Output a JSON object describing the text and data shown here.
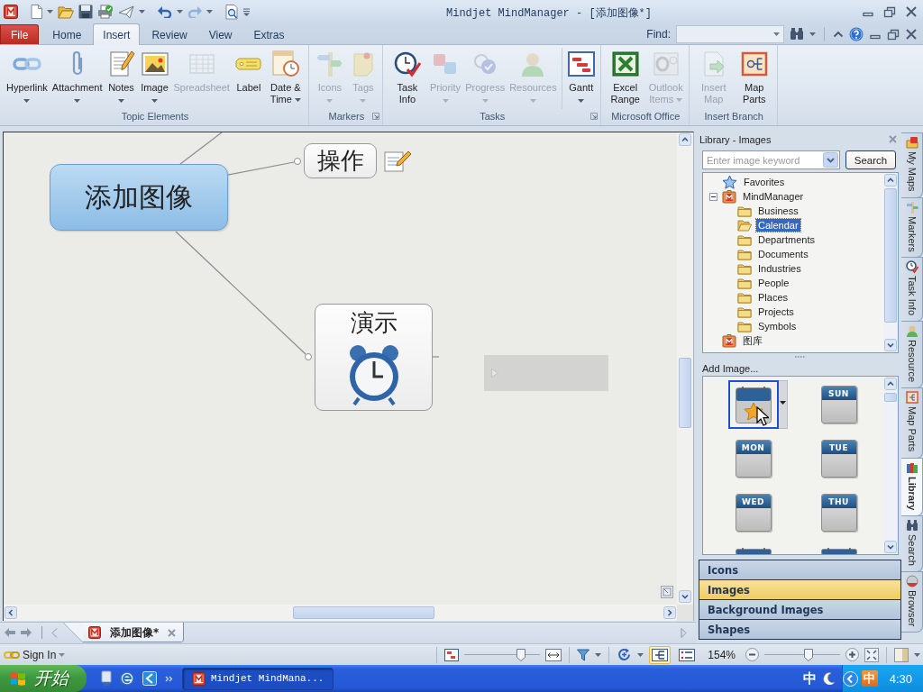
{
  "window": {
    "title": "Mindjet MindManager - [添加图像*]"
  },
  "ribbon_tabs": [
    {
      "label": "File",
      "kind": "file",
      "selected": false
    },
    {
      "label": "Home",
      "kind": "tab",
      "selected": false
    },
    {
      "label": "Insert",
      "kind": "tab",
      "selected": true
    },
    {
      "label": "Review",
      "kind": "tab",
      "selected": false
    },
    {
      "label": "View",
      "kind": "tab",
      "selected": false
    },
    {
      "label": "Extras",
      "kind": "tab",
      "selected": false
    }
  ],
  "find": {
    "label": "Find:"
  },
  "ribbon_groups": [
    {
      "label": "Topic Elements",
      "launcher": false,
      "sections": [
        [
          {
            "label": "Hyperlink",
            "disabled": false,
            "dropdown": true
          },
          {
            "label": "Attachment",
            "disabled": false,
            "dropdown": true
          },
          {
            "label": "Notes",
            "disabled": false,
            "dropdown": true
          },
          {
            "label": "Image",
            "disabled": false,
            "dropdown": true
          },
          {
            "label": "Spreadsheet",
            "disabled": true,
            "dropdown": false
          },
          {
            "label": "Label",
            "disabled": false,
            "dropdown": false
          },
          {
            "label": "Date & Time",
            "disabled": false,
            "dropdown": true
          }
        ]
      ]
    },
    {
      "label": "Markers",
      "launcher": true,
      "sections": [
        [
          {
            "label": "Icons",
            "disabled": true,
            "dropdown": true
          },
          {
            "label": "Tags",
            "disabled": true,
            "dropdown": true
          }
        ]
      ]
    },
    {
      "label": "Tasks",
      "launcher": true,
      "sections": [
        [
          {
            "label": "Task Info",
            "disabled": false,
            "dropdown": false
          },
          {
            "label": "Priority",
            "disabled": true,
            "dropdown": true
          },
          {
            "label": "Progress",
            "disabled": true,
            "dropdown": true
          },
          {
            "label": "Resources",
            "disabled": true,
            "dropdown": true
          }
        ],
        [
          {
            "label": "Gantt",
            "disabled": false,
            "dropdown": true
          }
        ]
      ]
    },
    {
      "label": "Microsoft Office",
      "launcher": false,
      "sections": [
        [
          {
            "label": "Excel Range",
            "disabled": false,
            "dropdown": false
          },
          {
            "label": "Outlook Items",
            "disabled": true,
            "dropdown": true
          }
        ]
      ]
    },
    {
      "label": "Insert Branch",
      "launcher": false,
      "sections": [
        [
          {
            "label": "Insert Map",
            "disabled": true,
            "dropdown": false
          },
          {
            "label": "Map Parts",
            "disabled": false,
            "dropdown": false
          }
        ]
      ]
    }
  ],
  "map": {
    "central_topic": {
      "text": "添加图像"
    },
    "topics": [
      {
        "text": "操作",
        "kind": "note"
      },
      {
        "text": "演示",
        "kind": "image"
      }
    ]
  },
  "library": {
    "title": "Library - Images",
    "search": {
      "placeholder": "Enter image keyword",
      "button": "Search"
    },
    "tree": [
      {
        "label": "Favorites",
        "kind": "favorites",
        "selected": false
      },
      {
        "label": "MindManager",
        "kind": "library",
        "expanded": true,
        "selected": false,
        "children": [
          {
            "label": "Business",
            "kind": "folder",
            "selected": false
          },
          {
            "label": "Calendar",
            "kind": "folder",
            "selected": true
          },
          {
            "label": "Departments",
            "kind": "folder",
            "selected": false
          },
          {
            "label": "Documents",
            "kind": "folder",
            "selected": false
          },
          {
            "label": "Industries",
            "kind": "folder",
            "selected": false
          },
          {
            "label": "People",
            "kind": "folder",
            "selected": false
          },
          {
            "label": "Places",
            "kind": "folder",
            "selected": false
          },
          {
            "label": "Projects",
            "kind": "folder",
            "selected": false
          },
          {
            "label": "Symbols",
            "kind": "folder",
            "selected": false
          }
        ]
      },
      {
        "label": "图库",
        "kind": "library",
        "selected": false
      }
    ],
    "add_image": "Add Image...",
    "images": [
      {
        "kind": "favorite",
        "selected": true
      },
      {
        "kind": "day",
        "day": "SUN",
        "selected": false
      },
      {
        "kind": "day",
        "day": "MON",
        "selected": false
      },
      {
        "kind": "day",
        "day": "TUE",
        "selected": false
      },
      {
        "kind": "day",
        "day": "WED",
        "selected": false
      },
      {
        "kind": "day",
        "day": "THU",
        "selected": false
      },
      {
        "kind": "partial",
        "selected": false
      },
      {
        "kind": "partial",
        "selected": false
      }
    ],
    "categories": [
      {
        "label": "Icons",
        "selected": false
      },
      {
        "label": "Images",
        "selected": true
      },
      {
        "label": "Background Images",
        "selected": false
      },
      {
        "label": "Shapes",
        "selected": false
      }
    ]
  },
  "side_tabs": [
    {
      "label": "My Maps",
      "selected": false
    },
    {
      "label": "Markers",
      "selected": false
    },
    {
      "label": "Task Info",
      "selected": false
    },
    {
      "label": "Resource",
      "selected": false
    },
    {
      "label": "Map Parts",
      "selected": false
    },
    {
      "label": "Library",
      "selected": true
    },
    {
      "label": "Search",
      "selected": false
    },
    {
      "label": "Browser",
      "selected": false
    }
  ],
  "document_tabs": [
    {
      "label": "添加图像*",
      "selected": true
    }
  ],
  "status_bar": {
    "sign_in": "Sign In",
    "detail_slider": {
      "level": 0.78
    },
    "view_modes": [
      {
        "selected": true
      },
      {
        "selected": false
      }
    ],
    "zoom": "154%",
    "zoom_slider": {
      "level": 0.6
    }
  },
  "taskbar": {
    "start": "开始",
    "tasks": [
      {
        "label": "Mindjet MindMana...",
        "selected": true
      }
    ],
    "language": "中",
    "ime": "中",
    "clock": "4:30"
  }
}
